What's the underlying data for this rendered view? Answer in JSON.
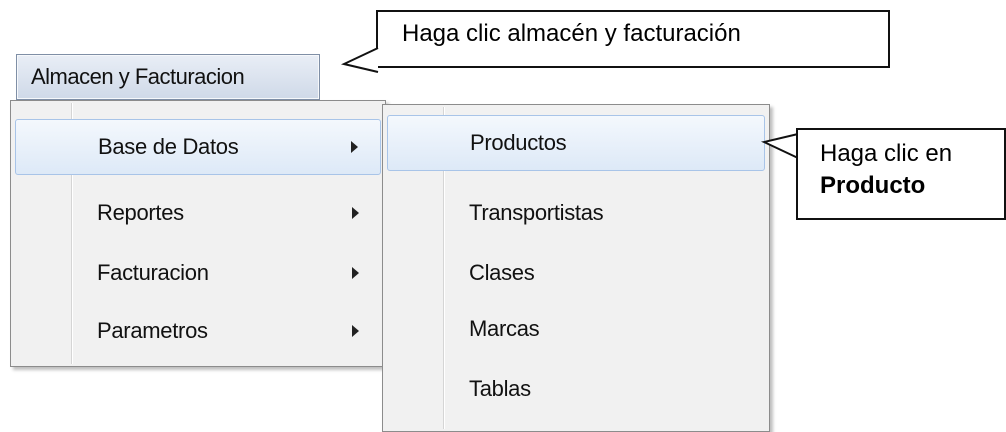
{
  "menubar": {
    "title": "Almacen y Facturacion"
  },
  "callouts": {
    "top": "Haga clic almacén y facturación",
    "right_line1": "Haga clic en",
    "right_line2": "Producto"
  },
  "menu_main": {
    "items": [
      {
        "label": "Base de Datos",
        "has_submenu": true,
        "highlighted": true
      },
      {
        "label": "Reportes",
        "has_submenu": true
      },
      {
        "label": "Facturacion",
        "has_submenu": true
      },
      {
        "label": "Parametros",
        "has_submenu": true
      }
    ]
  },
  "menu_sub": {
    "items": [
      {
        "label": "Productos",
        "highlighted": true
      },
      {
        "label": "Transportistas"
      },
      {
        "label": "Clases"
      },
      {
        "label": "Marcas"
      },
      {
        "label": "Tablas"
      }
    ]
  },
  "icons": {
    "submenu_arrow": "triangle-right-icon"
  }
}
